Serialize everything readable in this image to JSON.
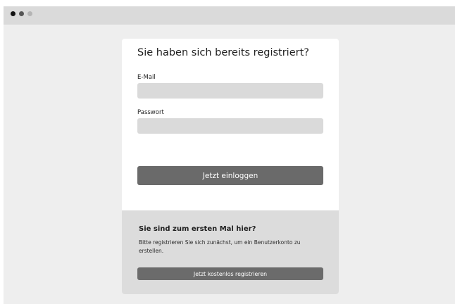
{
  "window": {
    "traffic_lights": [
      "close",
      "minimize",
      "maximize"
    ]
  },
  "login": {
    "title": "Sie haben sich bereits registriert?",
    "email_label": "E-Mail",
    "email_value": "",
    "password_label": "Passwort",
    "password_value": "",
    "submit_label": "Jetzt einloggen"
  },
  "register": {
    "title": "Sie sind zum ersten Mal hier?",
    "text": "Bitte registrieren Sie sich zunächst, um ein Benutzerkonto zu erstellen.",
    "button_label": "Jetzt kostenlos registrieren"
  },
  "colors": {
    "page_background": "#eeeeee",
    "titlebar": "#dadada",
    "input_background": "#dadada",
    "button": "#6a6a6a",
    "footer_background": "#dcdcdc"
  }
}
